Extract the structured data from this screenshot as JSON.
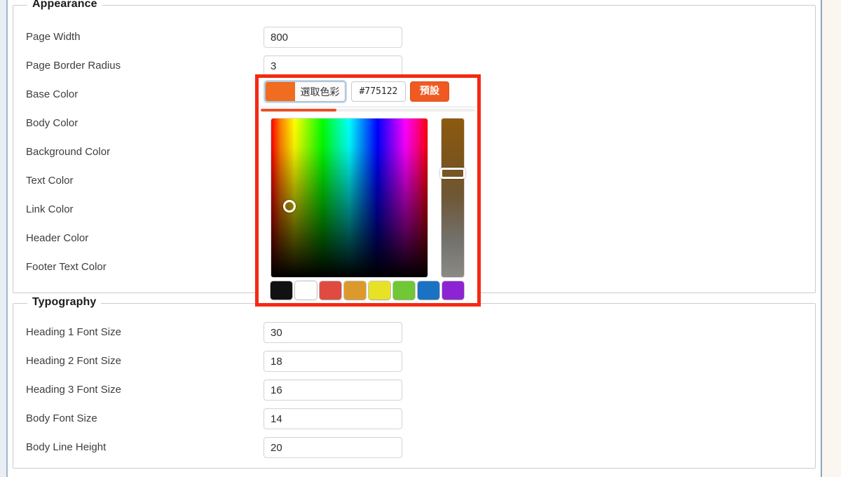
{
  "appearance": {
    "legend": "Appearance",
    "fields": [
      {
        "label": "Page Width",
        "value": "800",
        "type": "text"
      },
      {
        "label": "Page Border Radius",
        "value": "3",
        "type": "text"
      },
      {
        "label": "Base Color",
        "value": "",
        "type": "color"
      },
      {
        "label": "Body Color",
        "value": "",
        "type": "color"
      },
      {
        "label": "Background Color",
        "value": "",
        "type": "color"
      },
      {
        "label": "Text Color",
        "value": "",
        "type": "color"
      },
      {
        "label": "Link Color",
        "value": "",
        "type": "color"
      },
      {
        "label": "Header Color",
        "value": "",
        "type": "color"
      },
      {
        "label": "Footer Text Color",
        "value": "",
        "type": "color"
      }
    ]
  },
  "typography": {
    "legend": "Typography",
    "fields": [
      {
        "label": "Heading 1 Font Size",
        "value": "30"
      },
      {
        "label": "Heading 2 Font Size",
        "value": "18"
      },
      {
        "label": "Heading 3 Font Size",
        "value": "16"
      },
      {
        "label": "Body Font Size",
        "value": "14"
      },
      {
        "label": "Body Line Height",
        "value": "20"
      }
    ]
  },
  "color_picker": {
    "pick_button_label": "選取色彩",
    "pick_button_swatch": "#ef6c21",
    "hex_value": "#775122",
    "default_button_label": "預設",
    "default_button_color": "#f05a22",
    "tab_indicator_color": "#e8512a",
    "slider_top_color": "#8c5a10",
    "slider_bottom_color": "#8a8a86",
    "cursor_position": {
      "x": "26",
      "y": "125"
    },
    "presets": [
      {
        "name": "black",
        "hex": "#111111"
      },
      {
        "name": "white",
        "hex": "#ffffff"
      },
      {
        "name": "red",
        "hex": "#e04b41"
      },
      {
        "name": "orange",
        "hex": "#dd9a2c"
      },
      {
        "name": "yellow",
        "hex": "#e8e226"
      },
      {
        "name": "green",
        "hex": "#6fc834"
      },
      {
        "name": "blue",
        "hex": "#1b72c4"
      },
      {
        "name": "purple",
        "hex": "#8c24d4"
      }
    ]
  },
  "highlight": {
    "color": "#f42a12"
  }
}
